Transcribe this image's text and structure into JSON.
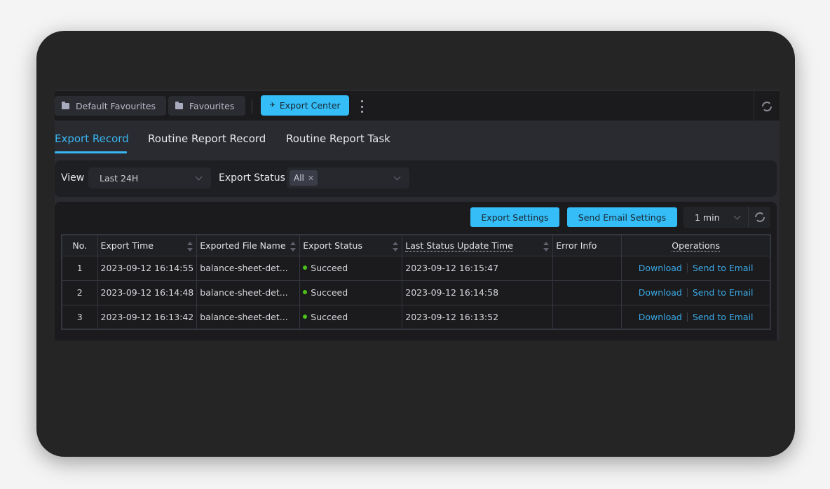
{
  "topbar": {
    "favourites": [
      {
        "label": "Default Favourites",
        "icon": "folder-icon"
      },
      {
        "label": "Favourites",
        "icon": "folder-icon"
      }
    ],
    "active_item": {
      "label": "Export Center",
      "icon": "pin-icon"
    },
    "more_icon": "kebab-icon",
    "refresh_icon": "refresh-icon"
  },
  "tabs": [
    {
      "label": "Export Record",
      "active": true
    },
    {
      "label": "Routine Report Record",
      "active": false
    },
    {
      "label": "Routine Report Task",
      "active": false
    }
  ],
  "filters": {
    "view_label": "View",
    "view_value": "Last 24H",
    "status_label": "Export Status",
    "status_tags": [
      "All"
    ]
  },
  "toolbar": {
    "export_settings": "Export Settings",
    "send_email_settings": "Send Email Settings",
    "refresh_interval": "1 min"
  },
  "table": {
    "columns": [
      "No.",
      "Export Time",
      "Exported File Name",
      "Export Status",
      "Last Status Update Time",
      "Error Info",
      "Operations"
    ],
    "rows": [
      {
        "no": "1",
        "export_time": "2023-09-12 16:14:55",
        "file_name": "balance-sheet-det...",
        "status": "Succeed",
        "last_update": "2023-09-12 16:15:47",
        "error": "",
        "op_download": "Download",
        "op_email": "Send to Email"
      },
      {
        "no": "2",
        "export_time": "2023-09-12 16:14:48",
        "file_name": "balance-sheet-det...",
        "status": "Succeed",
        "last_update": "2023-09-12 16:14:58",
        "error": "",
        "op_download": "Download",
        "op_email": "Send to Email"
      },
      {
        "no": "3",
        "export_time": "2023-09-12 16:13:42",
        "file_name": "balance-sheet-det...",
        "status": "Succeed",
        "last_update": "2023-09-12 16:13:52",
        "error": "",
        "op_download": "Download",
        "op_email": "Send to Email"
      }
    ]
  },
  "colors": {
    "accent": "#34bdf7",
    "link": "#3aa9e6",
    "success": "#4cc21a"
  }
}
